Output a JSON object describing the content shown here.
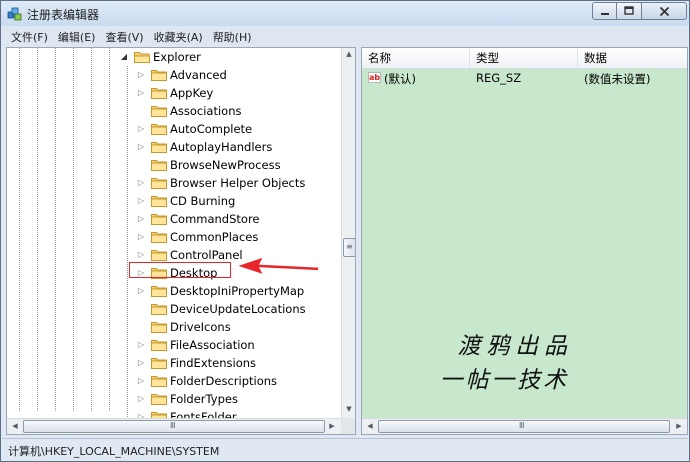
{
  "window": {
    "title": "注册表编辑器",
    "controls": [
      "minimize",
      "maximize",
      "close"
    ]
  },
  "menu": [
    "文件(F)",
    "编辑(E)",
    "查看(V)",
    "收藏夹(A)",
    "帮助(H)"
  ],
  "tree": {
    "root": "Explorer",
    "root_expanded": true,
    "items": [
      {
        "label": "Advanced",
        "expandable": true
      },
      {
        "label": "AppKey",
        "expandable": true
      },
      {
        "label": "Associations",
        "expandable": false
      },
      {
        "label": "AutoComplete",
        "expandable": true
      },
      {
        "label": "AutoplayHandlers",
        "expandable": true
      },
      {
        "label": "BrowseNewProcess",
        "expandable": false
      },
      {
        "label": "Browser Helper Objects",
        "expandable": true
      },
      {
        "label": "CD Burning",
        "expandable": true
      },
      {
        "label": "CommandStore",
        "expandable": true
      },
      {
        "label": "CommonPlaces",
        "expandable": true
      },
      {
        "label": "ControlPanel",
        "expandable": true
      },
      {
        "label": "Desktop",
        "expandable": true,
        "highlighted": true
      },
      {
        "label": "DesktopIniPropertyMap",
        "expandable": true
      },
      {
        "label": "DeviceUpdateLocations",
        "expandable": false
      },
      {
        "label": "DriveIcons",
        "expandable": false
      },
      {
        "label": "FileAssociation",
        "expandable": true
      },
      {
        "label": "FindExtensions",
        "expandable": true
      },
      {
        "label": "FolderDescriptions",
        "expandable": true
      },
      {
        "label": "FolderTypes",
        "expandable": true
      },
      {
        "label": "FontsFolder",
        "expandable": true
      }
    ],
    "scroll_grip": "Ⅲ"
  },
  "list": {
    "columns": {
      "name": "名称",
      "type": "类型",
      "data": "数据"
    },
    "rows": [
      {
        "icon": "ab",
        "name": "(默认)",
        "type": "REG_SZ",
        "data": "(数值未设置)"
      }
    ],
    "scroll_grip": "Ⅲ",
    "background_color": "#c7e8cc"
  },
  "watermark": {
    "line1": "渡鸦出品",
    "line2": "一帖一技术"
  },
  "annotation": {
    "color": "#e8262a"
  },
  "status": {
    "path": "计算机\\HKEY_LOCAL_MACHINE\\SYSTEM"
  }
}
